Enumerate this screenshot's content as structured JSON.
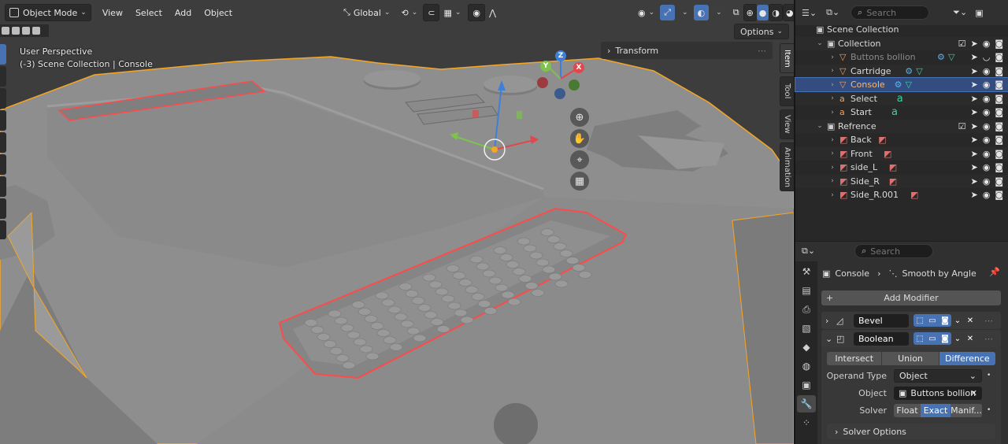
{
  "header": {
    "mode": "Object Mode",
    "menus": [
      "View",
      "Select",
      "Add",
      "Object"
    ],
    "orientation": "Global",
    "options": "Options"
  },
  "viewport": {
    "perspective": "User Perspective",
    "context": "(-3) Scene Collection | Console",
    "transform_panel": "Transform",
    "side_tabs": [
      "Item",
      "Tool",
      "View",
      "Animation"
    ],
    "gizmo": {
      "x": "X",
      "y": "Y",
      "z": "Z"
    },
    "colors": {
      "bg": "#3d3d3d",
      "model": "#8c8c8c",
      "selection_outline": "#f5a623",
      "boolean_outline": "#ff4a4a"
    }
  },
  "outliner": {
    "search_placeholder": "Search",
    "rows": [
      {
        "label": "Scene Collection",
        "type": "scene"
      },
      {
        "label": "Collection",
        "type": "collection"
      },
      {
        "label": "Buttons bollion",
        "type": "mesh"
      },
      {
        "label": "Cartridge",
        "type": "mesh"
      },
      {
        "label": "Console",
        "type": "mesh",
        "selected": true
      },
      {
        "label": "Select",
        "type": "text"
      },
      {
        "label": "Start",
        "type": "text"
      },
      {
        "label": "Refrence",
        "type": "collection"
      },
      {
        "label": "Back",
        "type": "image"
      },
      {
        "label": "Front",
        "type": "image"
      },
      {
        "label": "side_L",
        "type": "image"
      },
      {
        "label": "Side_R",
        "type": "image"
      },
      {
        "label": "Side_R.001",
        "type": "image"
      }
    ]
  },
  "properties": {
    "search_placeholder": "Search",
    "breadcrumb_object": "Console",
    "breadcrumb_modifier": "Smooth by Angle",
    "add_modifier": "Add Modifier",
    "modifiers": [
      {
        "name": "Bevel",
        "expanded": false
      },
      {
        "name": "Boolean",
        "expanded": true
      }
    ],
    "operation": {
      "options": [
        "Intersect",
        "Union",
        "Difference"
      ],
      "selected": "Difference"
    },
    "operand_type_label": "Operand Type",
    "operand_type": "Object",
    "object_label": "Object",
    "object_value": "Buttons bollion",
    "solver_label": "Solver",
    "solver": {
      "options": [
        "Float",
        "Exact",
        "Manif..."
      ],
      "selected": "Exact"
    },
    "solver_options": "Solver Options"
  }
}
